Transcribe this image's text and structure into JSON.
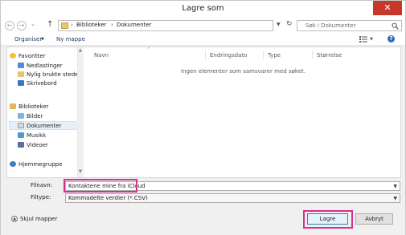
{
  "window": {
    "title": "Lagre som",
    "close_label": "✕"
  },
  "nav": {
    "back": "←",
    "forward": "→",
    "recent": "⌄",
    "up": "↑",
    "breadcrumb": [
      "Biblioteker",
      "Dokumenter"
    ],
    "breadcrumb_sep": "›",
    "refresh": "↻",
    "search_placeholder": "Søk i Dokumenter"
  },
  "toolbar": {
    "organize": "Organiser",
    "new_folder": "Ny mappe",
    "help": "?"
  },
  "navpane": {
    "favorites_header": "Favoritter",
    "favorites": [
      "Nedlastinger",
      "Nylig brukte steder",
      "Skrivebord"
    ],
    "libraries_header": "Biblioteker",
    "libraries": [
      "Bilder",
      "Dokumenter",
      "Musikk",
      "Videoer"
    ],
    "homegroup": "Hjemmegruppe"
  },
  "columns": [
    "Navn",
    "Endringsdato",
    "Type",
    "Størrelse"
  ],
  "empty_message": "Ingen elementer som samsvarer med søket.",
  "form": {
    "filename_label": "Filnavn:",
    "filename_value": "Kontaktene mine fra iCloud",
    "filetype_label": "Filtype:",
    "filetype_value": "Kommadelte verdier (*.CSV)"
  },
  "footer": {
    "hide_folders": "Skjul mapper",
    "save": "Lagre",
    "cancel": "Avbryt"
  },
  "colors": {
    "highlight": "#d6318f",
    "close": "#c7382a",
    "selection": "#e5f0fb"
  }
}
